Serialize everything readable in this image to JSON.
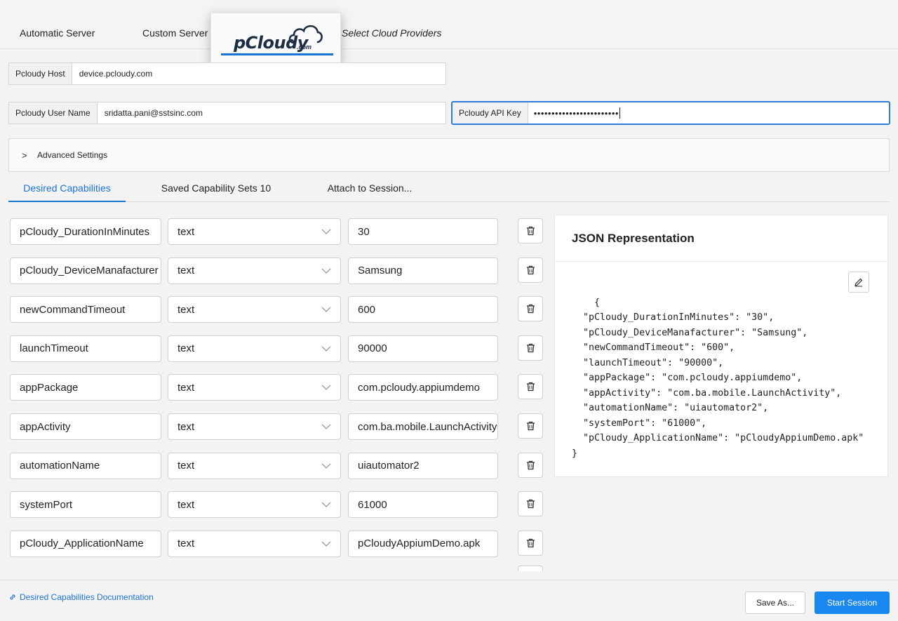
{
  "server_tabs": {
    "automatic": "Automatic Server",
    "custom": "Custom Server",
    "cloud": "Select Cloud Providers",
    "logo_main": "pCloudy",
    "logo_com": ".com"
  },
  "fields": {
    "host_label": "Pcloudy Host",
    "host_value": "device.pcloudy.com",
    "user_label": "Pcloudy User Name",
    "user_value": "sridatta.pani@sstsinc.com",
    "apikey_label": "Pcloudy API Key",
    "apikey_masked": "••••••••••••••••••••••••"
  },
  "advanced": {
    "label": "Advanced Settings",
    "chevron": ">"
  },
  "cap_tabs": {
    "desired": "Desired Capabilities",
    "saved": "Saved Capability Sets 10",
    "attach": "Attach to Session..."
  },
  "capabilities": [
    {
      "name": "pCloudy_DurationInMinutes",
      "type": "text",
      "value": "30"
    },
    {
      "name": "pCloudy_DeviceManafacturer",
      "type": "text",
      "value": "Samsung"
    },
    {
      "name": "newCommandTimeout",
      "type": "text",
      "value": "600"
    },
    {
      "name": "launchTimeout",
      "type": "text",
      "value": "90000"
    },
    {
      "name": "appPackage",
      "type": "text",
      "value": "com.pcloudy.appiumdemo"
    },
    {
      "name": "appActivity",
      "type": "text",
      "value": "com.ba.mobile.LaunchActivity"
    },
    {
      "name": "automationName",
      "type": "text",
      "value": "uiautomator2"
    },
    {
      "name": "systemPort",
      "type": "text",
      "value": "61000"
    },
    {
      "name": "pCloudy_ApplicationName",
      "type": "text",
      "value": "pCloudyAppiumDemo.apk"
    }
  ],
  "json_panel": {
    "title": "JSON Representation",
    "content": "{\n  \"pCloudy_DurationInMinutes\": \"30\",\n  \"pCloudy_DeviceManafacturer\": \"Samsung\",\n  \"newCommandTimeout\": \"600\",\n  \"launchTimeout\": \"90000\",\n  \"appPackage\": \"com.pcloudy.appiumdemo\",\n  \"appActivity\": \"com.ba.mobile.LaunchActivity\",\n  \"automationName\": \"uiautomator2\",\n  \"systemPort\": \"61000\",\n  \"pCloudy_ApplicationName\": \"pCloudyAppiumDemo.apk\"\n}"
  },
  "footer": {
    "doc_link": "Desired Capabilities Documentation",
    "save_as": "Save As...",
    "start_session": "Start Session"
  },
  "colors": {
    "accent": "#1a73d6",
    "primary_button": "#1a86f0",
    "logo_dark": "#1d2d44"
  },
  "icons": [
    "link-icon",
    "trash-icon",
    "pencil-icon",
    "chevron-down-icon",
    "chevron-right-icon",
    "cloud-logo-icon"
  ]
}
